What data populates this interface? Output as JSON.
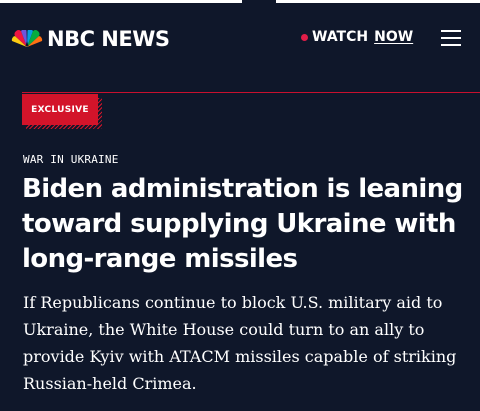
{
  "header": {
    "logo_text": "NBC NEWS",
    "watch_label": "WATCH",
    "now_label": "NOW",
    "icons": {
      "logo": "nbc-peacock-icon",
      "live": "live-dot-icon",
      "menu": "hamburger-menu-icon"
    }
  },
  "article": {
    "badge": "EXCLUSIVE",
    "kicker": "WAR IN UKRAINE",
    "headline": "Biden administration is leaning toward supplying Ukraine with long-range missiles",
    "dek": "If Republicans continue to block U.S. military aid to Ukraine, the White House could turn to an ally to provide Kyiv with ATACM missiles capable of striking Russian-held Crimea."
  },
  "colors": {
    "background": "#0f172a",
    "accent_red": "#d3142a",
    "live_dot": "#e11d48",
    "text": "#ffffff",
    "peacock": [
      "#fccc12",
      "#ef1541",
      "#6e55dc",
      "#069de0",
      "#05ac3f",
      "#ff7112"
    ]
  }
}
